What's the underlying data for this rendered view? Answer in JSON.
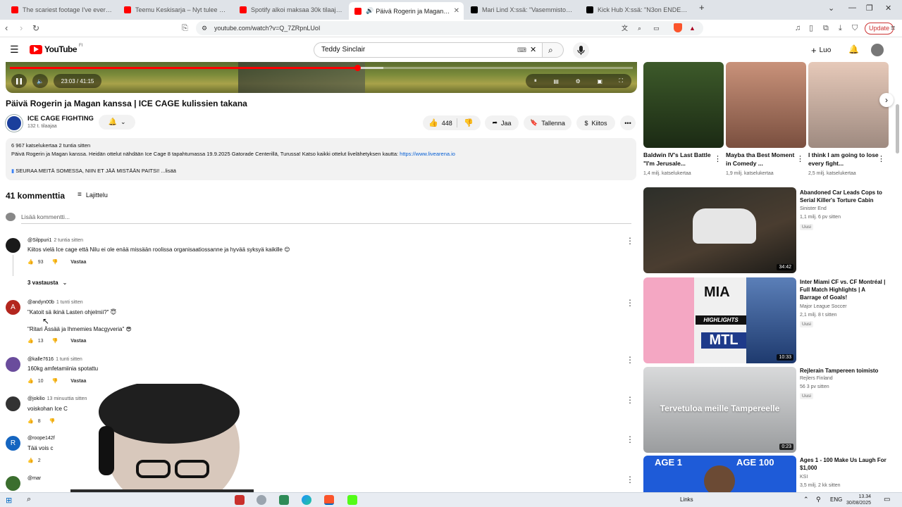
{
  "browser": {
    "tabs": [
      {
        "title": "The scariest footage I've ever seen...",
        "favicon_color": "#ff0000"
      },
      {
        "title": "Teemu Keskisarja – Nyt tulee täysisiä",
        "favicon_color": "#ff0000"
      },
      {
        "title": "Spotify alkoi maksaa 30k tilaajaa & 3",
        "favicon_color": "#ff0000"
      },
      {
        "title": "Päivä Rogerin ja Magan kans",
        "favicon_color": "#ff0000",
        "active": true
      },
      {
        "title": "Mari Lind X:ssä: \"Vasemmistoliitto s",
        "favicon_color": "#000000"
      },
      {
        "title": "Kick Hub X:ssä: \"N3on ENDED his str",
        "favicon_color": "#000000"
      }
    ],
    "url": "youtube.com/watch?v=Q_7ZRpnLUoI",
    "update_label": "Update"
  },
  "yt_header": {
    "logo_text": "YouTube",
    "country_code": "FI",
    "search_value": "Teddy Sinclair",
    "create_label": "Luo"
  },
  "player": {
    "time": "23:03 / 41:15",
    "progress": 0.558,
    "buffered": 0.6
  },
  "video": {
    "title": "Päivä Rogerin ja Magan kanssa | ICE CAGE kulissien takana",
    "channel": "ICE CAGE FIGHTING",
    "subscribers": "132 t. tilaajaa",
    "likes": "448",
    "share_label": "Jaa",
    "save_label": "Tallenna",
    "thanks_label": "Kiitos",
    "description": {
      "stats": "6 967 katselukertaa  2 tuntia sitten",
      "text": "Päivä Rogerin ja Magan kanssa. Heidän ottelut nähdään Ice Cage 8 tapahtumassa 19.9.2025 Gatorade Centerillä, Turussa! Katso kaikki ottelut livelähetyksen kautta: ",
      "link": "https://www.livearena.io",
      "follow": "SEURAA MEITÄ SOMESSA, NIIN ET JÄÄ MISTÄÄN PAITSI! ...lisää"
    }
  },
  "comments": {
    "count_label": "41 kommenttia",
    "sort_label": "Lajittelu",
    "add_placeholder": "Lisää kommentti...",
    "reply_label": "Vastaa",
    "replies_toggle": "3 vastausta",
    "items": [
      {
        "author": "@Silppuri1",
        "time": "2 tuntia sitten",
        "text": "Kiitos vielä Ice cage että Nilu ei ole enää missään roolissa organisaatiossanne ja hyvää syksyä kaikille 😊",
        "likes": "93",
        "avatar_color": "#1a1a1a",
        "avatar_letter": ""
      },
      {
        "author": "@andyn00b",
        "time": "1 tunti sitten",
        "text": "\"Katoit sä ikinä Lasten ohjelmii?\" 😇",
        "text2": "\"Ritari Ässää ja Ihmemies Macgyveria\" 😎",
        "likes": "13",
        "avatar_color": "#b3261e",
        "avatar_letter": "A"
      },
      {
        "author": "@kalle7616",
        "time": "1 tunti sitten",
        "text": "160kg amfetamiinia spotattu",
        "likes": "10",
        "avatar_color": "#6a4c9c",
        "avatar_letter": ""
      },
      {
        "author": "@jokilio",
        "time": "13 minuuttia sitten",
        "text": "voisko­han Ice C",
        "likes": "8",
        "avatar_color": "#333333",
        "avatar_letter": ""
      },
      {
        "author": "@roope142f",
        "time": "",
        "text": "Tää vois c",
        "likes": "2",
        "avatar_color": "#1565c0",
        "avatar_letter": "R"
      },
      {
        "author": "@mar",
        "time": "",
        "text": "",
        "likes": "",
        "avatar_color": "#3b6e2e",
        "avatar_letter": ""
      }
    ]
  },
  "sidebar": {
    "shorts": [
      {
        "title": "Baldwin IV's Last Battle \"I'm Jerusale...",
        "views": "1,4 milj. katselukertaa",
        "thumb_color": "#3d5a2a"
      },
      {
        "title": "Mayba tha Best Moment in Comedy ...",
        "views": "1,9 milj. katselukertaa",
        "thumb_color": "#b0785a"
      },
      {
        "title": "I think I am going to lose every fight...",
        "views": "2,5 milj. katselukertaa",
        "thumb_color": "#d8b6a4"
      }
    ],
    "videos": [
      {
        "title": "Abandoned Car Leads Cops to Serial Killer's Torture Cabin",
        "channel": "Sinister End",
        "meta": "1,1 milj.  6 pv sitten",
        "badge": "Uusi",
        "duration": "34:42",
        "thumb_color": "#2d2f2a"
      },
      {
        "title": "Inter Miami CF vs. CF Montréal | Full Match Highlights | A Barrage of Goals!",
        "channel": "Major League Soccer",
        "meta": "2,1 milj.  8 t sitten",
        "badge": "Uusi",
        "duration": "10:33",
        "thumb_color": "#f4a7c3"
      },
      {
        "title": "Rejlerain Tampereen toimisto",
        "channel": "Rejlers Finland",
        "meta": "56  3 pv sitten",
        "badge": "Uusi",
        "duration": "0:23",
        "thumb_color": "#bcbcbc",
        "thumb_text": "Tervetuloa meille Tampereelle"
      },
      {
        "title": "Ages 1 - 100 Make Us Laugh For $1,000",
        "channel": "KSI",
        "meta": "3,5 milj.  2 kk sitten",
        "badge": "",
        "duration": "",
        "thumb_color": "#1e5bd8",
        "thumb_label_left": "AGE 1",
        "thumb_label_right": "AGE 100"
      }
    ],
    "mia_texts": [
      "MIA",
      "HIGHLIGHTS",
      "MTL"
    ]
  },
  "taskbar": {
    "links_label": "Links",
    "lang": "ENG",
    "time": "13.34",
    "date": "30/08/2025"
  }
}
